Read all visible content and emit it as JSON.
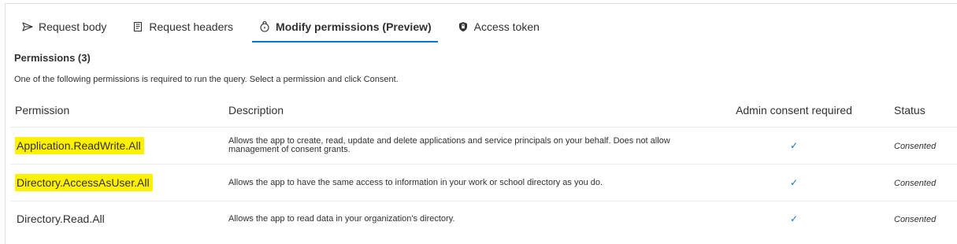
{
  "tabs": [
    {
      "label": "Request body",
      "icon": "send-icon",
      "active": false
    },
    {
      "label": "Request headers",
      "icon": "document-icon",
      "active": false
    },
    {
      "label": "Modify permissions (Preview)",
      "icon": "lock-shield-icon",
      "active": true
    },
    {
      "label": "Access token",
      "icon": "shield-lock-icon",
      "active": false
    }
  ],
  "section": {
    "title": "Permissions (3)",
    "description": "One of the following permissions is required to run the query. Select a permission and click Consent."
  },
  "table": {
    "headers": {
      "permission": "Permission",
      "description": "Description",
      "admin": "Admin consent required",
      "status": "Status"
    },
    "rows": [
      {
        "permission": "Application.ReadWrite.All",
        "description": "Allows the app to create, read, update and delete applications and service principals on your behalf. Does not allow management of consent grants.",
        "admin_required": true,
        "status": "Consented",
        "highlighted": true
      },
      {
        "permission": "Directory.AccessAsUser.All",
        "description": "Allows the app to have the same access to information in your work or school directory as you do.",
        "admin_required": true,
        "status": "Consented",
        "highlighted": true
      },
      {
        "permission": "Directory.Read.All",
        "description": "Allows the app to read data in your organization's directory.",
        "admin_required": true,
        "status": "Consented",
        "highlighted": false
      }
    ]
  },
  "colors": {
    "accent": "#0078d4",
    "highlight": "#fff100"
  }
}
